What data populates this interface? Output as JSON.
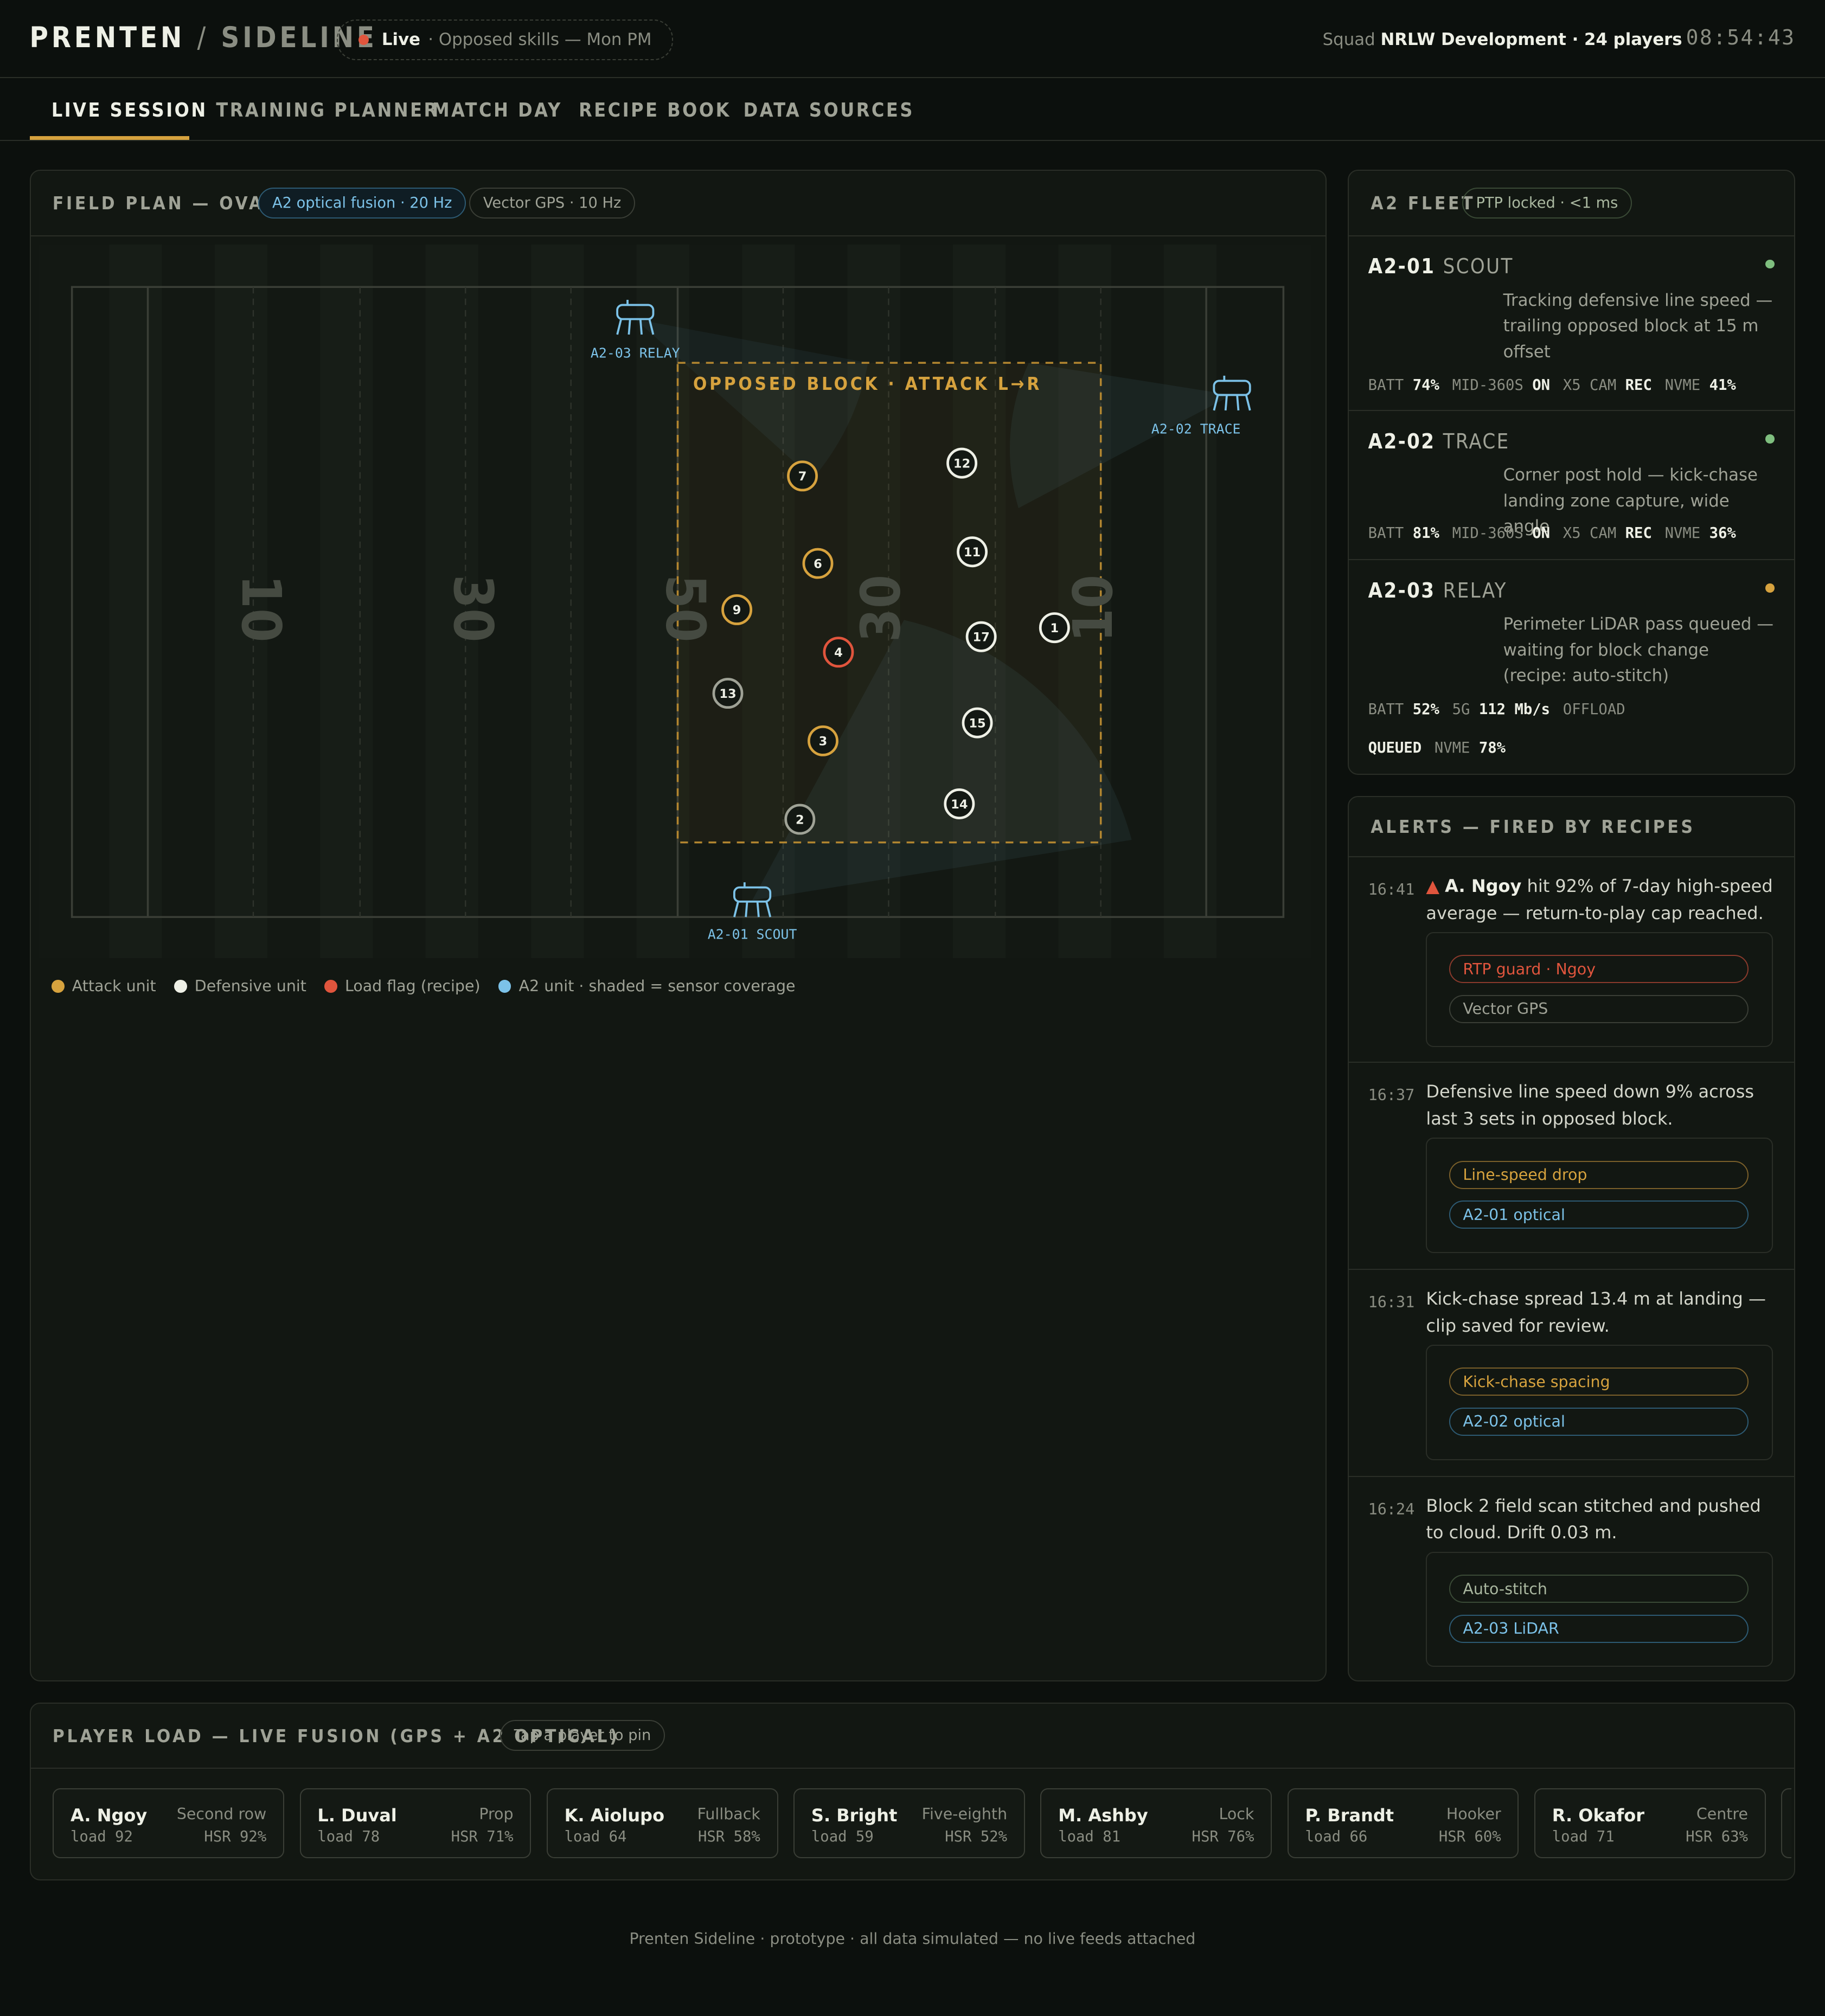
{
  "brand": {
    "name": "PRENTEN",
    "sep": "/",
    "sub": "SIDELINE"
  },
  "live": {
    "label": "Live",
    "detail": "· Opposed skills — Mon PM"
  },
  "squad": {
    "prefix": "Squad",
    "name": "NRLW Development · 24 players"
  },
  "clock": "08:54:43",
  "nav": [
    "LIVE SESSION",
    "TRAINING PLANNER",
    "MATCH DAY",
    "RECIPE BOOK",
    "DATA SOURCES"
  ],
  "field": {
    "title": "FIELD PLAN — OVAL 2",
    "chip_fusion": "A2 optical fusion · 20 Hz",
    "chip_gps": "Vector GPS · 10 Hz",
    "block_label": "OPPOSED BLOCK · ATTACK L→R",
    "yard_numbers": [
      "10",
      "30",
      "50",
      "30",
      "10"
    ],
    "units": [
      "A2-03 RELAY",
      "A2-02 TRACE",
      "A2-01 SCOUT"
    ],
    "players": [
      {
        "n": "7",
        "team": "attack"
      },
      {
        "n": "6",
        "team": "attack"
      },
      {
        "n": "9",
        "team": "attack"
      },
      {
        "n": "4",
        "team": "flag"
      },
      {
        "n": "13",
        "team": "neutral"
      },
      {
        "n": "3",
        "team": "attack"
      },
      {
        "n": "2",
        "team": "neutral"
      },
      {
        "n": "12",
        "team": "defense"
      },
      {
        "n": "11",
        "team": "defense"
      },
      {
        "n": "17",
        "team": "defense"
      },
      {
        "n": "1",
        "team": "defense"
      },
      {
        "n": "15",
        "team": "defense"
      },
      {
        "n": "14",
        "team": "defense"
      }
    ],
    "legend": [
      "Attack unit",
      "Defensive unit",
      "Load flag (recipe)",
      "A2 unit · shaded = sensor coverage"
    ]
  },
  "fleet": {
    "title": "A2 FLEET",
    "chip": "PTP locked · <1 ms",
    "units": [
      {
        "id": "A2-01",
        "role": "SCOUT",
        "status_color": "#7fbf7f",
        "desc": "Tracking defensive line speed — trailing opposed block at 15 m offset",
        "stats": [
          [
            "BATT",
            "74%"
          ],
          [
            "MID-360S",
            "ON"
          ],
          [
            "X5 CAM",
            "REC"
          ],
          [
            "NVME",
            "41%"
          ]
        ]
      },
      {
        "id": "A2-02",
        "role": "TRACE",
        "status_color": "#7fbf7f",
        "desc": "Corner post hold — kick-chase landing zone capture, wide angle",
        "stats": [
          [
            "BATT",
            "81%"
          ],
          [
            "MID-360S",
            "ON"
          ],
          [
            "X5 CAM",
            "REC"
          ],
          [
            "NVME",
            "36%"
          ]
        ]
      },
      {
        "id": "A2-03",
        "role": "RELAY",
        "status_color": "#d6a23e",
        "desc": "Perimeter LiDAR pass queued — waiting for block change (recipe: auto-stitch)",
        "stats": [
          [
            "BATT",
            "52%"
          ],
          [
            "5G",
            "112 Mb/s"
          ],
          [
            "OFFLOAD",
            "QUEUED"
          ],
          [
            "NVME",
            "78%"
          ]
        ]
      }
    ]
  },
  "alerts": {
    "title": "ALERTS — FIRED BY RECIPES",
    "items": [
      {
        "time": "16:41",
        "who": "A. Ngoy",
        "text": " hit 92% of 7-day high-speed average — return-to-play cap reached.",
        "tags": [
          [
            "RTP guard · Ngoy",
            "red"
          ],
          [
            "Vector GPS",
            "gray"
          ]
        ]
      },
      {
        "time": "16:37",
        "who": "",
        "text": "Defensive line speed down 9% across last 3 sets in opposed block.",
        "tags": [
          [
            "Line-speed drop",
            "amber"
          ],
          [
            "A2-01 optical",
            "blue"
          ]
        ]
      },
      {
        "time": "16:31",
        "who": "",
        "text": "Kick-chase spread 13.4 m at landing — clip saved for review.",
        "tags": [
          [
            "Kick-chase spacing",
            "amber"
          ],
          [
            "A2-02 optical",
            "blue"
          ]
        ]
      },
      {
        "time": "16:24",
        "who": "",
        "text": "Block 2 field scan stitched and pushed to cloud. Drift 0.03 m.",
        "tags": [
          [
            "Auto-stitch",
            "green"
          ],
          [
            "A2-03 LiDAR",
            "blue"
          ]
        ]
      }
    ]
  },
  "load": {
    "title": "PLAYER LOAD — LIVE FUSION (GPS + A2 OPTICAL)",
    "chip": "Tap a player to pin",
    "players": [
      {
        "name": "A. Ngoy",
        "pos": "Second row",
        "load": "load 92",
        "hsr": "HSR 92%"
      },
      {
        "name": "L. Duval",
        "pos": "Prop",
        "load": "load 78",
        "hsr": "HSR 71%"
      },
      {
        "name": "K. Aiolupo",
        "pos": "Fullback",
        "load": "load 64",
        "hsr": "HSR 58%"
      },
      {
        "name": "S. Bright",
        "pos": "Five-eighth",
        "load": "load 59",
        "hsr": "HSR 52%"
      },
      {
        "name": "M. Ashby",
        "pos": "Lock",
        "load": "load 81",
        "hsr": "HSR 76%"
      },
      {
        "name": "P. Brandt",
        "pos": "Hooker",
        "load": "load 66",
        "hsr": "HSR 60%"
      },
      {
        "name": "R. Okafor",
        "pos": "Centre",
        "load": "load 71",
        "hsr": "HSR 63%"
      }
    ]
  },
  "footer": "Prenten Sideline · prototype · all data simulated — no live feeds attached",
  "colors": {
    "attack": "#d6a23e",
    "defense": "#eef0e6",
    "flag": "#e0553d",
    "unit": "#7cc2e8",
    "neutral": "#9fa296"
  }
}
